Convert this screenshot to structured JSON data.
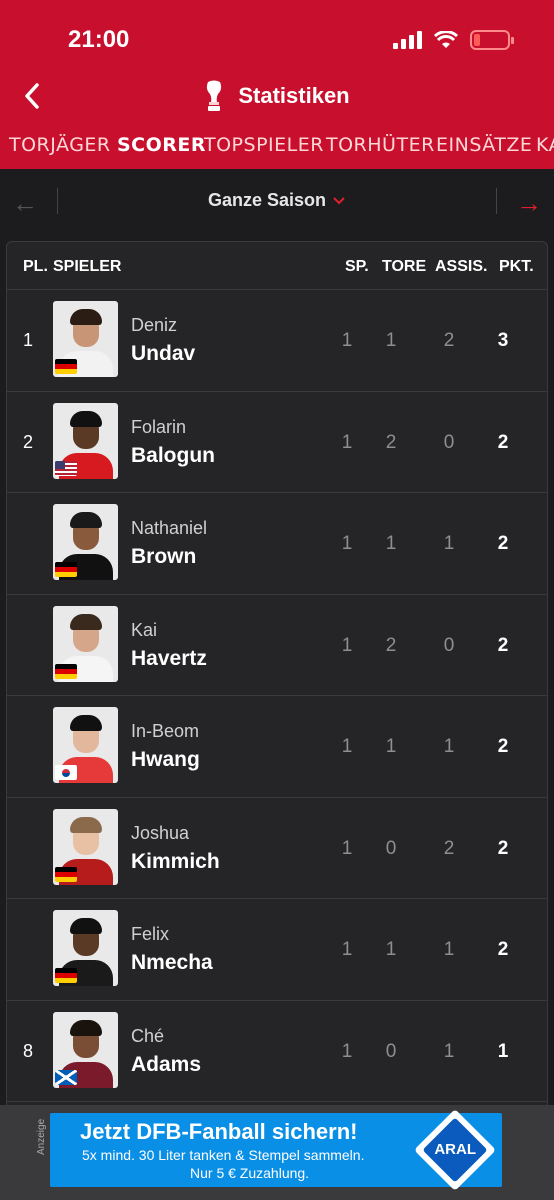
{
  "status": {
    "time": "21:00"
  },
  "header": {
    "title": "Statistiken"
  },
  "tabs": [
    "TORJÄGER",
    "SCORER",
    "TOPSPIELER",
    "TORHÜTER",
    "EINSÄTZE",
    "KA"
  ],
  "active_tab": "SCORER",
  "season": {
    "label": "Ganze Saison"
  },
  "table": {
    "headers": {
      "rank": "PL.",
      "player": "SPIELER",
      "games": "SP.",
      "goals": "TORE",
      "assists": "ASSIS.",
      "points": "PKT."
    },
    "rows": [
      {
        "rank": "1",
        "first": "Deniz",
        "last": "Undav",
        "flag": "germany-flag",
        "games": "1",
        "goals": "1",
        "assists": "2",
        "points": "3"
      },
      {
        "rank": "2",
        "first": "Folarin",
        "last": "Balogun",
        "flag": "usa-flag",
        "games": "1",
        "goals": "2",
        "assists": "0",
        "points": "2"
      },
      {
        "rank": "",
        "first": "Nathaniel",
        "last": "Brown",
        "flag": "germany-flag",
        "games": "1",
        "goals": "1",
        "assists": "1",
        "points": "2"
      },
      {
        "rank": "",
        "first": "Kai",
        "last": "Havertz",
        "flag": "germany-flag",
        "games": "1",
        "goals": "2",
        "assists": "0",
        "points": "2"
      },
      {
        "rank": "",
        "first": "In-Beom",
        "last": "Hwang",
        "flag": "south-korea-flag",
        "games": "1",
        "goals": "1",
        "assists": "1",
        "points": "2"
      },
      {
        "rank": "",
        "first": "Joshua",
        "last": "Kimmich",
        "flag": "germany-flag",
        "games": "1",
        "goals": "0",
        "assists": "2",
        "points": "2"
      },
      {
        "rank": "",
        "first": "Felix",
        "last": "Nmecha",
        "flag": "germany-flag",
        "games": "1",
        "goals": "1",
        "assists": "1",
        "points": "2"
      },
      {
        "rank": "8",
        "first": "Ché",
        "last": "Adams",
        "flag": "scotland-flag",
        "games": "1",
        "goals": "0",
        "assists": "1",
        "points": "1"
      }
    ]
  },
  "ad": {
    "label": "Anzeige",
    "headline": "Jetzt DFB-Fanball sichern!",
    "line1": "5x mind. 30 Liter tanken & Stempel sammeln.",
    "line2": "Nur 5 € Zuzahlung.",
    "brand": "ARAL"
  },
  "colors": {
    "brand_red": "#c8102e",
    "background": "#1c1c1e",
    "accent_arrow": "#e0202c",
    "ad_blue": "#0a8fe6"
  }
}
